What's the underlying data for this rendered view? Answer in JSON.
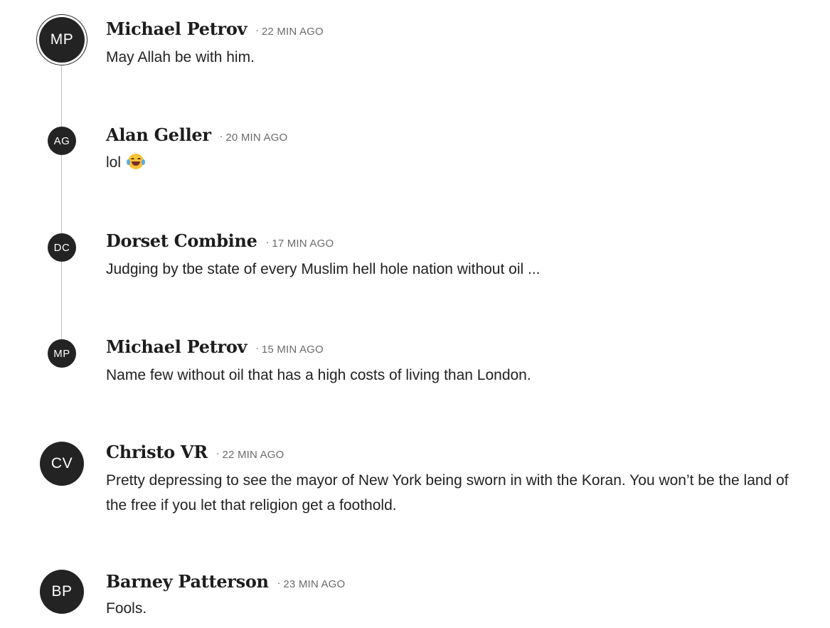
{
  "comments": [
    {
      "initials": "MP",
      "author": "Michael Petrov",
      "time": "22 MIN AGO",
      "text": "May Allah be with him."
    },
    {
      "initials": "AG",
      "author": "Alan Geller",
      "time": "20 MIN AGO",
      "text": "lol",
      "emoji": "rolling-on-floor-laughing-emoji"
    },
    {
      "initials": "DC",
      "author": "Dorset Combine",
      "time": "17 MIN AGO",
      "text": "Judging by tbe state of every Muslim hell hole nation without oil ..."
    },
    {
      "initials": "MP",
      "author": "Michael Petrov",
      "time": "15 MIN AGO",
      "text": "Name few without oil that has a high costs of living than London."
    },
    {
      "initials": "CV",
      "author": "Christo VR",
      "time": "22 MIN AGO",
      "text": "Pretty depressing to see the mayor of New York being sworn in with the Koran. You won’t be the land of the free if you let that religion get a foothold."
    },
    {
      "initials": "BP",
      "author": "Barney Patterson",
      "time": "23 MIN AGO",
      "text": "Fools."
    }
  ],
  "separator": "·",
  "colors": {
    "avatar_bg": "#232323",
    "avatar_text": "#ffffff",
    "thread_line": "#bdbdbd",
    "timestamp": "#6b6b6b"
  }
}
